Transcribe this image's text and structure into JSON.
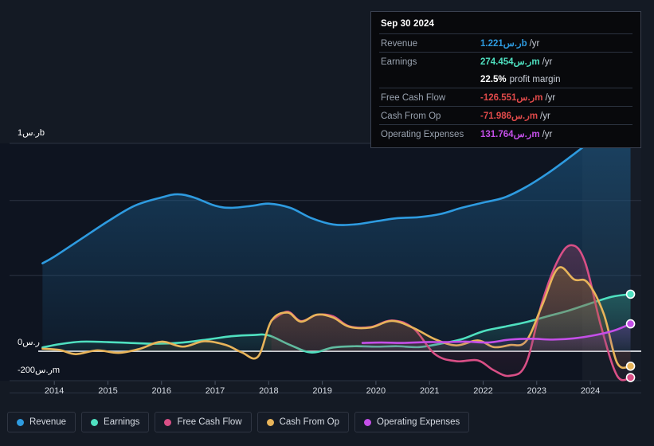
{
  "tooltip": {
    "date": "Sep 30 2024",
    "rows": [
      {
        "label": "Revenue",
        "value": "1.221ر.سb",
        "unit": "/yr",
        "color": "#2E9BE0"
      },
      {
        "label": "Earnings",
        "value": "274.454ر.سm",
        "unit": "/yr",
        "color": "#4FE0C0"
      },
      {
        "label": "",
        "value": "22.5%",
        "unit": "",
        "sub": "profit margin",
        "color": "#ffffff"
      },
      {
        "label": "Free Cash Flow",
        "value": "-126.551ر.سm",
        "unit": "/yr",
        "color": "#E04A4A"
      },
      {
        "label": "Cash From Op",
        "value": "-71.986ر.سm",
        "unit": "/yr",
        "color": "#E04A4A"
      },
      {
        "label": "Operating Expenses",
        "value": "131.764ر.سm",
        "unit": "/yr",
        "color": "#C44FE8"
      }
    ]
  },
  "axes": {
    "y_top_label": "1ر.سb",
    "y_zero_label": "0ر.س",
    "y_bottom_label": "-200ر.سm",
    "x_ticks": [
      "2014",
      "2015",
      "2016",
      "2017",
      "2018",
      "2019",
      "2020",
      "2021",
      "2022",
      "2023",
      "2024"
    ]
  },
  "legend": [
    {
      "label": "Revenue",
      "color": "#2E9BE0"
    },
    {
      "label": "Earnings",
      "color": "#4FE0C0"
    },
    {
      "label": "Free Cash Flow",
      "color": "#D94F86"
    },
    {
      "label": "Cash From Op",
      "color": "#E8B45A"
    },
    {
      "label": "Operating Expenses",
      "color": "#C44FE8"
    }
  ],
  "chart_data": {
    "type": "area",
    "title": "",
    "xlabel": "",
    "ylabel": "",
    "currency": "ر.س",
    "grid": true,
    "legend_position": "bottom",
    "xlim": [
      2013.7,
      2024.95
    ],
    "ylim": [
      -200000000,
      1100000000
    ],
    "y_gridline_values": [
      1000000000,
      725000000,
      365000000,
      0,
      -200000000
    ],
    "forecast_band": {
      "start": 2023.85,
      "end": 2024.95
    },
    "series": [
      {
        "name": "Revenue",
        "color": "#2E9BE0",
        "fill": "rgba(30,90,140,0.45)",
        "x": [
          2013.78,
          2014.0,
          2014.5,
          2015.0,
          2015.5,
          2016.0,
          2016.3,
          2016.6,
          2017.0,
          2017.3,
          2017.7,
          2018.0,
          2018.4,
          2018.8,
          2019.2,
          2019.6,
          2020.0,
          2020.4,
          2020.8,
          2021.2,
          2021.6,
          2022.0,
          2022.4,
          2022.8,
          2023.2,
          2023.6,
          2024.0,
          2024.4,
          2024.75
        ],
        "y": [
          423000000,
          455000000,
          540000000,
          625000000,
          700000000,
          740000000,
          755000000,
          740000000,
          700000000,
          690000000,
          700000000,
          710000000,
          690000000,
          640000000,
          610000000,
          610000000,
          625000000,
          640000000,
          645000000,
          660000000,
          690000000,
          715000000,
          740000000,
          790000000,
          855000000,
          930000000,
          1010000000,
          1100000000,
          1170000000
        ]
      },
      {
        "name": "Earnings",
        "color": "#4FE0C0",
        "fill": "rgba(60,150,135,0.32)",
        "x": [
          2013.78,
          2014.1,
          2014.5,
          2015.0,
          2015.4,
          2015.9,
          2016.4,
          2016.9,
          2017.3,
          2017.7,
          2018.0,
          2018.4,
          2018.8,
          2019.2,
          2019.6,
          2020.0,
          2020.4,
          2020.8,
          2021.2,
          2021.6,
          2022.0,
          2022.4,
          2022.8,
          2023.2,
          2023.6,
          2024.0,
          2024.4,
          2024.75
        ],
        "y": [
          18000000,
          34000000,
          46000000,
          44000000,
          40000000,
          36000000,
          42000000,
          58000000,
          72000000,
          78000000,
          76000000,
          30000000,
          -6000000,
          18000000,
          24000000,
          22000000,
          24000000,
          20000000,
          36000000,
          58000000,
          96000000,
          118000000,
          140000000,
          168000000,
          196000000,
          230000000,
          262000000,
          274454000
        ]
      },
      {
        "name": "Free Cash Flow",
        "color": "#D94F86",
        "fill": "rgba(150,60,95,0.30)",
        "x": [
          2018.05,
          2018.35,
          2018.6,
          2018.9,
          2019.2,
          2019.5,
          2019.9,
          2020.3,
          2020.7,
          2021.1,
          2021.5,
          2021.9,
          2022.2,
          2022.5,
          2022.8,
          2023.1,
          2023.4,
          2023.65,
          2023.9,
          2024.2,
          2024.5,
          2024.75
        ],
        "y": [
          148000000,
          190000000,
          145000000,
          175000000,
          168000000,
          120000000,
          116000000,
          148000000,
          110000000,
          -14000000,
          -48000000,
          -44000000,
          -92000000,
          -118000000,
          -60000000,
          235000000,
          440000000,
          510000000,
          430000000,
          120000000,
          -118000000,
          -126551000
        ]
      },
      {
        "name": "Cash From Op",
        "color": "#E8B45A",
        "fill": "rgba(150,115,60,0.30)",
        "x": [
          2013.78,
          2014.1,
          2014.4,
          2014.8,
          2015.2,
          2015.6,
          2016.0,
          2016.4,
          2016.8,
          2017.2,
          2017.5,
          2017.8,
          2018.05,
          2018.35,
          2018.6,
          2018.9,
          2019.2,
          2019.5,
          2019.9,
          2020.3,
          2020.7,
          2021.1,
          2021.5,
          2021.9,
          2022.2,
          2022.5,
          2022.8,
          2023.1,
          2023.4,
          2023.7,
          2023.95,
          2024.25,
          2024.5,
          2024.75
        ],
        "y": [
          12000000,
          6000000,
          -14000000,
          4000000,
          -8000000,
          12000000,
          46000000,
          22000000,
          48000000,
          30000000,
          -6000000,
          -26000000,
          146000000,
          186000000,
          142000000,
          176000000,
          162000000,
          118000000,
          114000000,
          146000000,
          112000000,
          58000000,
          28000000,
          52000000,
          20000000,
          30000000,
          48000000,
          220000000,
          400000000,
          345000000,
          330000000,
          180000000,
          -56000000,
          -71986000
        ]
      },
      {
        "name": "Operating Expenses",
        "color": "#C44FE8",
        "fill": "rgba(120,60,160,0.28)",
        "x": [
          2019.75,
          2020.1,
          2020.5,
          2020.9,
          2021.3,
          2021.7,
          2022.1,
          2022.5,
          2022.9,
          2023.3,
          2023.7,
          2024.1,
          2024.45,
          2024.75
        ],
        "y": [
          40000000,
          42000000,
          40000000,
          44000000,
          44000000,
          46000000,
          42000000,
          56000000,
          60000000,
          56000000,
          62000000,
          78000000,
          100000000,
          131764000
        ]
      }
    ]
  }
}
